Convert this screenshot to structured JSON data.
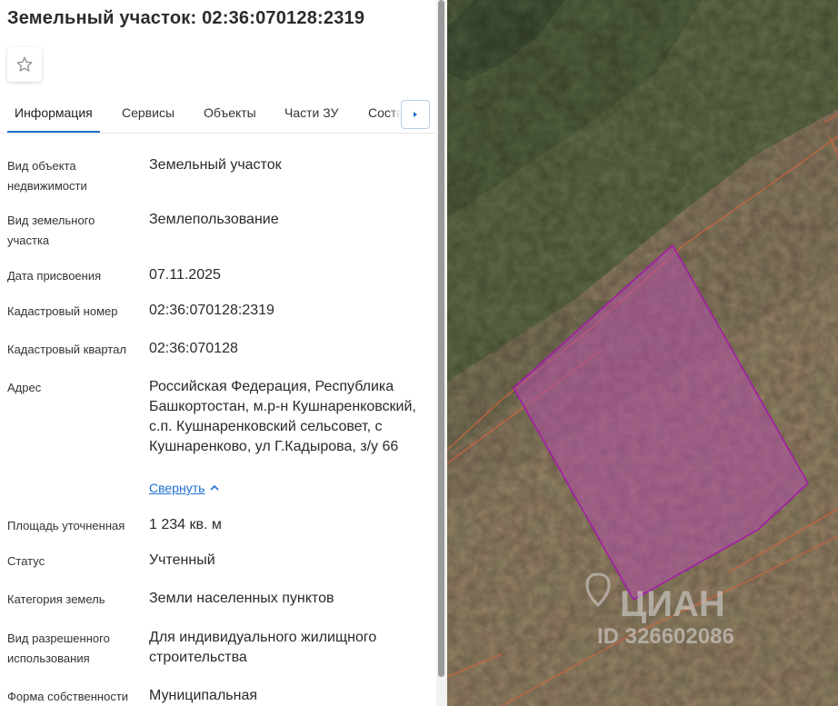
{
  "title": "Земельный участок: 02:36:070128:2319",
  "tabs": [
    {
      "label": "Информация",
      "active": true
    },
    {
      "label": "Сервисы"
    },
    {
      "label": "Объекты"
    },
    {
      "label": "Части ЗУ"
    },
    {
      "label": "Соста"
    }
  ],
  "fields": [
    {
      "label": "Вид объекта недвижимости",
      "value": "Земельный участок"
    },
    {
      "label": "Вид земельного участка",
      "value": "Землепользование"
    },
    {
      "label": "Дата присвоения",
      "value": "07.11.2025"
    },
    {
      "label": "Кадастровый номер",
      "value": "02:36:070128:2319"
    },
    {
      "label": "Кадастровый квартал",
      "value": "02:36:070128"
    },
    {
      "label": "Адрес",
      "value": "Российская Федерация, Республика Башкортостан, м.р-н Кушнаренковский, с.п. Кушнаренковский сельсовет, с Кушнаренково, ул Г.Кадырова, з/у 66"
    },
    {
      "label": "Площадь уточненная",
      "value": "1 234 кв. м"
    },
    {
      "label": "Статус",
      "value": "Учтенный"
    },
    {
      "label": "Категория земель",
      "value": "Земли населенных пунктов"
    },
    {
      "label": "Вид разрешенного использования",
      "value": "Для индивидуального жилищного строительства"
    },
    {
      "label": "Форма собственности",
      "value": "Муниципальная"
    }
  ],
  "collapse_label": "Свернуть",
  "watermark": {
    "brand": "ЦИАН",
    "id": "ID 326602086"
  },
  "colors": {
    "accent": "#1f6fd1",
    "parcel_fill": "#b24ea8",
    "parcel_stroke": "#a21ca6",
    "boundary": "#d9643c"
  },
  "icons": {
    "favorite": "star-icon",
    "tabs_next": "chevron-right-icon",
    "collapse": "chevron-up-icon"
  }
}
